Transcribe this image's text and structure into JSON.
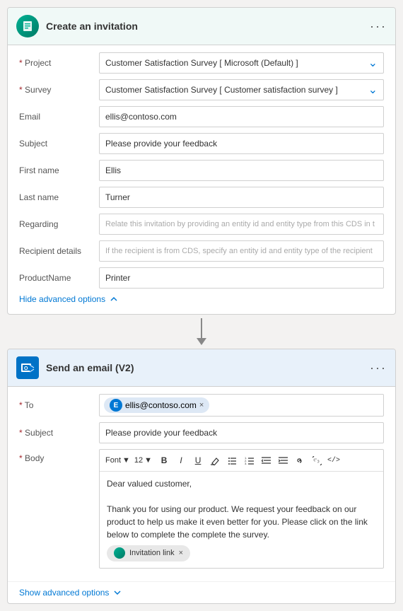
{
  "card1": {
    "title": "Create an invitation",
    "icon_label": "survey-icon",
    "fields": [
      {
        "label": "Project",
        "required": true,
        "value": "Customer Satisfaction Survey [ Microsoft (Default) ]",
        "type": "dropdown"
      },
      {
        "label": "Survey",
        "required": true,
        "value": "Customer Satisfaction Survey [ Customer satisfaction survey ]",
        "type": "dropdown"
      },
      {
        "label": "Email",
        "required": false,
        "value": "ellis@contoso.com",
        "type": "text"
      },
      {
        "label": "Subject",
        "required": false,
        "value": "Please provide your feedback",
        "type": "text"
      },
      {
        "label": "First name",
        "required": false,
        "value": "Ellis",
        "type": "text"
      },
      {
        "label": "Last name",
        "required": false,
        "value": "Turner",
        "type": "text"
      },
      {
        "label": "Regarding",
        "required": false,
        "value": "Relate this invitation by providing an entity id and entity type from this CDS in t",
        "type": "text"
      },
      {
        "label": "Recipient details",
        "required": false,
        "value": "If the recipient is from CDS, specify an entity id and entity type of the recipient",
        "type": "text"
      },
      {
        "label": "ProductName",
        "required": false,
        "value": "Printer",
        "type": "text"
      }
    ],
    "toggle_label": "Hide advanced options",
    "toggle_icon": "chevron-up"
  },
  "card2": {
    "title": "Send an email (V2)",
    "icon_label": "outlook-icon",
    "to_label": "To",
    "to_required": true,
    "to_email": "ellis@contoso.com",
    "to_avatar": "E",
    "subject_label": "Subject",
    "subject_required": true,
    "subject_value": "Please provide your feedback",
    "body_label": "Body",
    "body_required": true,
    "toolbar": {
      "font": "Font",
      "font_size": "12",
      "bold": "B",
      "italic": "I",
      "underline": "U",
      "highlight": "✏",
      "bullet_list": "≡",
      "numbered_list": "≣",
      "outdent": "⇤",
      "indent": "⇥",
      "link": "🔗",
      "unlink": "⛓",
      "code": "</>",
      "dropdown_arrow": "▼"
    },
    "body_text_line1": "Dear valued customer,",
    "body_text_line2": "Thank you for using our product. We request your feedback on our product to help us make it even better for you. Please click on the link below to complete the complete the survey.",
    "invitation_tag": "Invitation link",
    "show_advanced": "Show advanced options",
    "toggle_icon": "chevron-down"
  },
  "colors": {
    "accent": "#0078d4",
    "required": "#a4262c",
    "header_bg1": "#f0f9f7",
    "header_bg2": "#e8f1fa"
  }
}
